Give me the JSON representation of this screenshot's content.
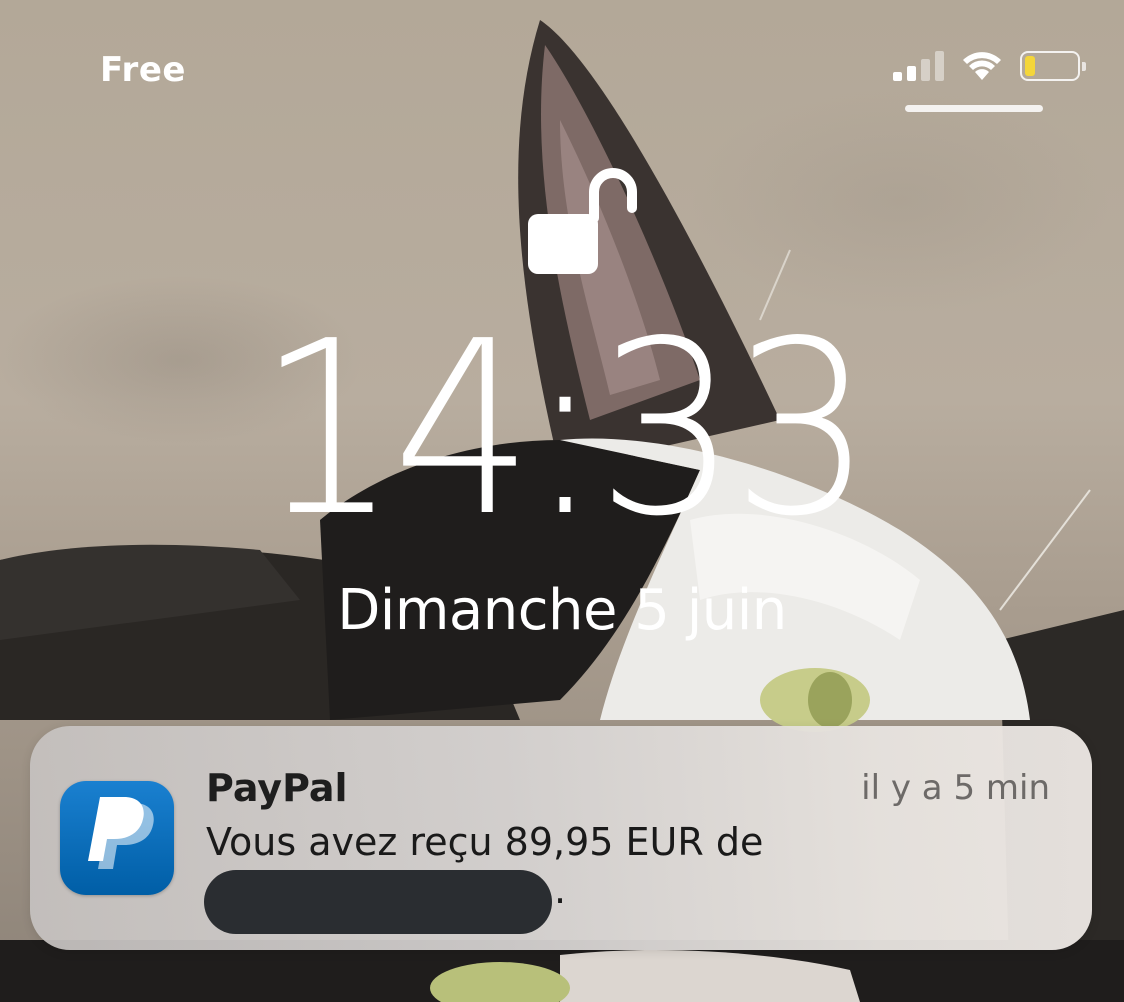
{
  "status_bar": {
    "carrier": "Free",
    "signal_bars": 2,
    "signal_bars_total": 4,
    "wifi_icon": "wifi-icon",
    "battery_level": 0.2,
    "battery_color": "#f4d63a"
  },
  "lock_screen": {
    "lock_icon": "unlocked-padlock-icon",
    "time": "14:33",
    "date": "Dimanche 5 juin"
  },
  "notification": {
    "app_icon": "paypal-icon",
    "app_name": "PayPal",
    "time_ago": "il y a 5 min",
    "message_line1": "Vous avez reçu 89,95 EUR de",
    "message_end": "."
  }
}
